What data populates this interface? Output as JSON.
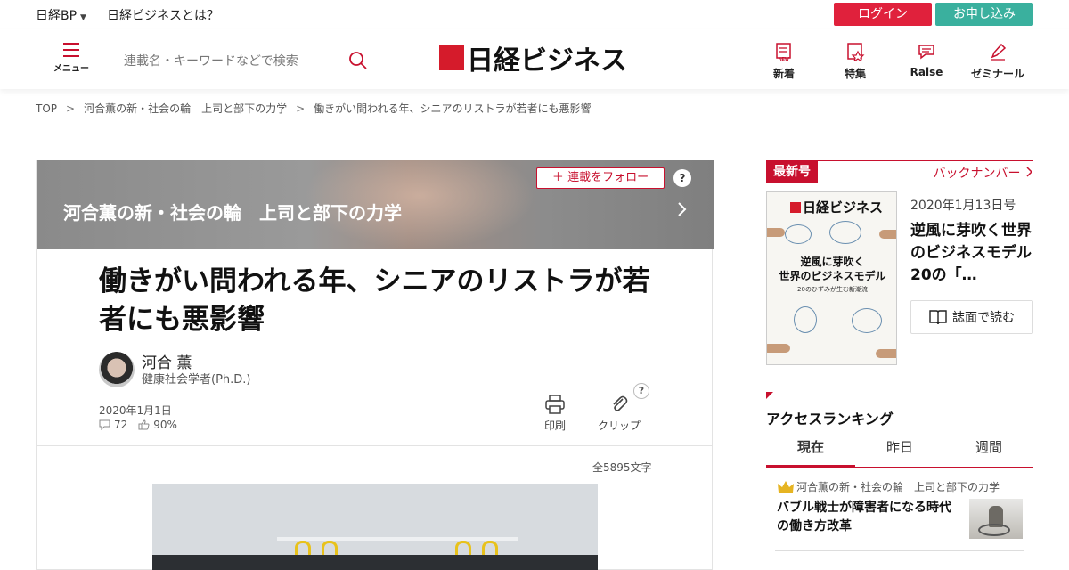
{
  "topbar": {
    "bp_label": "日経BP",
    "about_label": "日経ビジネスとは？",
    "login_label": "ログイン",
    "apply_label": "お申し込み"
  },
  "header": {
    "menu_label": "メニュー",
    "search_placeholder": "連載名・キーワードなどで検索",
    "logo_text": "日経ビジネス",
    "nav": [
      {
        "label": "新着",
        "icon": "new-icon"
      },
      {
        "label": "特集",
        "icon": "feature-icon"
      },
      {
        "label": "Raise",
        "icon": "raise-icon"
      },
      {
        "label": "ゼミナール",
        "icon": "pen-icon"
      }
    ]
  },
  "breadcrumb": [
    "TOP",
    "河合薫の新・社会の輪　上司と部下の力学",
    "働きがい問われる年、シニアのリストラが若者にも悪影響"
  ],
  "article": {
    "series_title": "河合薫の新・社会の輪　上司と部下の力学",
    "follow_label": "連載をフォロー",
    "title": "働きがい問われる年、シニアのリストラが若者にも悪影響",
    "author_name": "河合 薫",
    "author_role": "健康社会学者(Ph.D.)",
    "date": "2020年1月1日",
    "comments": "72",
    "likes": "90%",
    "print_label": "印刷",
    "clip_label": "クリップ",
    "char_count": "全5895文字"
  },
  "sidebar": {
    "latest_tag": "最新号",
    "back_numbers_label": "バックナンバー",
    "cover_brand": "日経ビジネス",
    "cover_headline_1": "逆風に芽吹く",
    "cover_headline_2": "世界のビジネスモデル",
    "cover_sub": "20のひずみが生む新潮流",
    "issue_date": "2020年1月13日号",
    "issue_title": "逆風に芽吹く世界のビジネスモデル　20の「…",
    "read_button": "誌面で読む",
    "ranking_title": "アクセスランキング",
    "tabs": [
      "現在",
      "昨日",
      "週間"
    ],
    "rank1_series": "河合薫の新・社会の輪　上司と部下の力学",
    "rank1_title": "バブル戦士が障害者になる時代の働き方改革"
  },
  "colors": {
    "accent": "#c8102e",
    "login": "#e0213c",
    "apply": "#3ab09e"
  }
}
